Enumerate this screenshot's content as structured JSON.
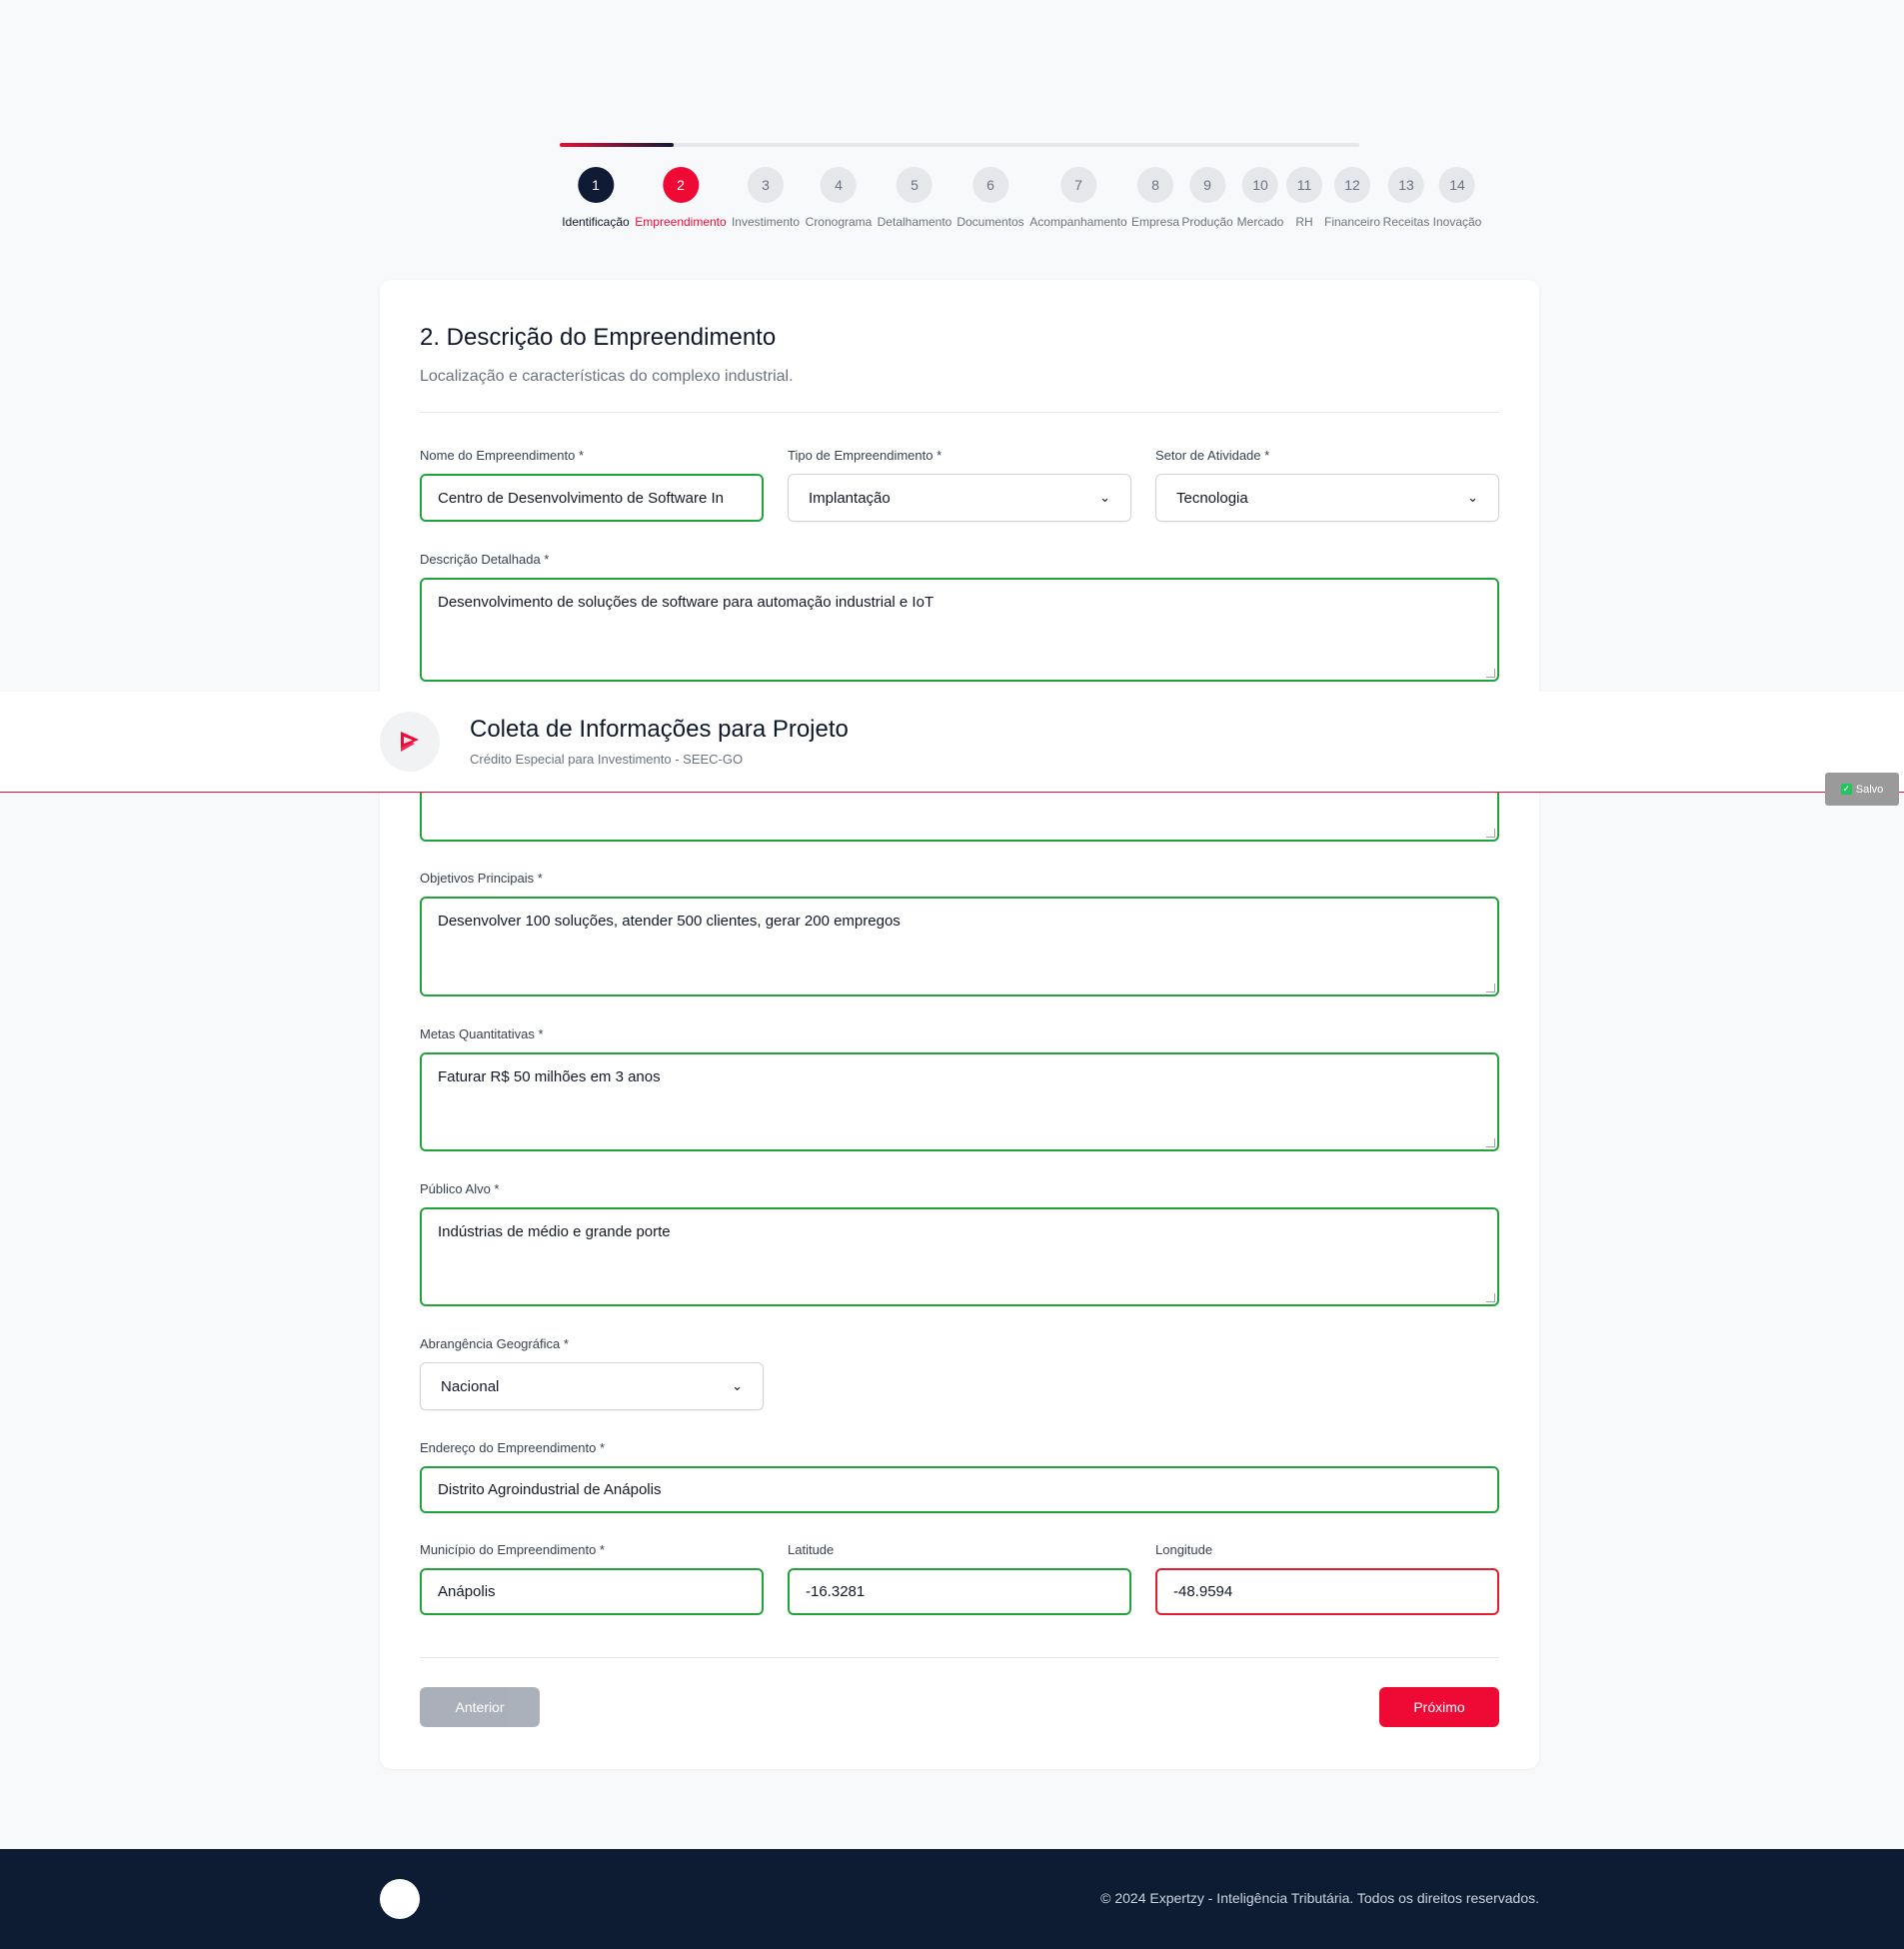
{
  "progress": {
    "fraction": 0.143
  },
  "steps": [
    {
      "num": "1",
      "label": "Identificação",
      "state": "done"
    },
    {
      "num": "2",
      "label": "Empreendimento",
      "state": "active"
    },
    {
      "num": "3",
      "label": "Investimento",
      "state": "todo"
    },
    {
      "num": "4",
      "label": "Cronograma",
      "state": "todo"
    },
    {
      "num": "5",
      "label": "Detalhamento",
      "state": "todo"
    },
    {
      "num": "6",
      "label": "Documentos",
      "state": "todo"
    },
    {
      "num": "7",
      "label": "Acompanhamento",
      "state": "todo"
    },
    {
      "num": "8",
      "label": "Empresa",
      "state": "todo"
    },
    {
      "num": "9",
      "label": "Produção",
      "state": "todo"
    },
    {
      "num": "10",
      "label": "Mercado",
      "state": "todo"
    },
    {
      "num": "11",
      "label": "RH",
      "state": "todo"
    },
    {
      "num": "12",
      "label": "Financeiro",
      "state": "todo"
    },
    {
      "num": "13",
      "label": "Receitas",
      "state": "todo"
    },
    {
      "num": "14",
      "label": "Inovação",
      "state": "todo"
    }
  ],
  "card": {
    "title": "2. Descrição do Empreendimento",
    "subtitle": "Localização e características do complexo industrial."
  },
  "form": {
    "nome": {
      "label": "Nome do Empreendimento *",
      "value": "Centro de Desenvolvimento de Software In"
    },
    "tipo": {
      "label": "Tipo de Empreendimento *",
      "value": "Implantação"
    },
    "setor": {
      "label": "Setor de Atividade *",
      "value": "Tecnologia"
    },
    "descricao": {
      "label": "Descrição Detalhada *",
      "value": "Desenvolvimento de soluções de software para automação industrial e IoT"
    },
    "objetivos": {
      "label": "Objetivos Principais *",
      "value": "Desenvolver 100 soluções, atender 500 clientes, gerar 200 empregos"
    },
    "metas": {
      "label": "Metas Quantitativas *",
      "value": "Faturar R$ 50 milhões em 3 anos"
    },
    "publico": {
      "label": "Público Alvo *",
      "value": "Indústrias de médio e grande porte"
    },
    "abrangencia": {
      "label": "Abrangência Geográfica *",
      "value": "Nacional"
    },
    "endereco": {
      "label": "Endereço do Empreendimento *",
      "value": "Distrito Agroindustrial de Anápolis"
    },
    "municipio": {
      "label": "Município do Empreendimento *",
      "value": "Anápolis"
    },
    "latitude": {
      "label": "Latitude",
      "value": "-16.3281"
    },
    "longitude": {
      "label": "Longitude",
      "value": "-48.9594"
    }
  },
  "buttons": {
    "previous": "Anterior",
    "next": "Próximo"
  },
  "header": {
    "title": "Coleta de Informações para Projeto",
    "subtitle": "Crédito Especial para Investimento - SEEC-GO",
    "saved": "Salvo"
  },
  "footer": {
    "text": "© 2024 Expertzy - Inteligência Tributária. Todos os direitos reservados."
  },
  "colors": {
    "accent": "#ef0a35",
    "dark": "#0d1b33",
    "valid": "#22a33a",
    "error": "#e11d2e"
  }
}
